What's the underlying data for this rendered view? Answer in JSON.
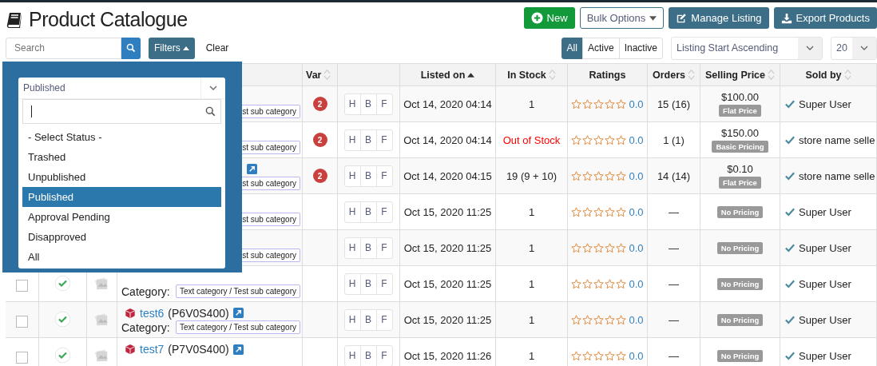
{
  "page_title": "Product Catalogue",
  "actions": [
    {
      "kind": "new",
      "label": "New"
    },
    {
      "kind": "bulk",
      "label": "Bulk Options"
    },
    {
      "kind": "manage",
      "label": "Manage Listing"
    },
    {
      "kind": "export",
      "label": "Export Products"
    }
  ],
  "search": {
    "placeholder": "Search"
  },
  "filters_button": {
    "label": "Filters",
    "expanded": true
  },
  "clear_link": "Clear",
  "status_tabs": [
    {
      "label": "All",
      "selected": true
    },
    {
      "label": "Active",
      "selected": false
    },
    {
      "label": "Inactive",
      "selected": false
    }
  ],
  "sort_select": {
    "value": "Listing Start Ascending"
  },
  "page_size_select": {
    "value": "20"
  },
  "filter_panel": {
    "status_select": {
      "value": "Published",
      "expanded": true
    },
    "options": [
      {
        "label": "- Select Status -",
        "selected": false
      },
      {
        "label": "Trashed",
        "selected": false
      },
      {
        "label": "Unpublished",
        "selected": false
      },
      {
        "label": "Published",
        "selected": true
      },
      {
        "label": "Approval Pending",
        "selected": false
      },
      {
        "label": "Disapproved",
        "selected": false
      },
      {
        "label": "All",
        "selected": false
      }
    ]
  },
  "table": {
    "columns": [
      {
        "label": "Var",
        "sortable": true,
        "sorted": false
      },
      {
        "sortable": false,
        "sorted": false
      },
      {
        "label": "Listed on",
        "sortable": true,
        "sorted": true
      },
      {
        "label": "In Stock",
        "sortable": true,
        "sorted": false
      },
      {
        "label": "Ratings",
        "sortable": false,
        "sorted": false
      },
      {
        "label": "Orders",
        "sortable": true,
        "sorted": false
      },
      {
        "label": "Selling Price",
        "sortable": true,
        "sorted": false
      },
      {
        "label": "Sold by",
        "sortable": true,
        "sorted": false
      }
    ],
    "rows": [
      {
        "product": {
          "category": "st sub category"
        },
        "variants": "2",
        "flags": [
          "H",
          "B",
          "F"
        ],
        "listed_on": "Oct 14, 2020 04:14",
        "in_stock": "1",
        "out_of_stock": false,
        "stars": 0,
        "rating": "0.0",
        "orders": "15 (16)",
        "price": "$100.00",
        "pricing": "Flat Price",
        "seller": "Super User"
      },
      {
        "product": {
          "category": "st sub category"
        },
        "variants": "2",
        "flags": [
          "H",
          "B",
          "F"
        ],
        "listed_on": "Oct 14, 2020 04:14",
        "in_stock": "Out of Stock",
        "out_of_stock": true,
        "stars": 0,
        "rating": "0.0",
        "orders": "1 (1)",
        "price": "$150.00",
        "pricing": "Basic Pricing",
        "seller": "store name selle"
      },
      {
        "product": {
          "link": true,
          "category": "st sub category"
        },
        "variants": "2",
        "flags": [
          "H",
          "B",
          "F"
        ],
        "listed_on": "Oct 14, 2020 04:15",
        "in_stock": "19 (9 + 10)",
        "out_of_stock": false,
        "stars": 0,
        "rating": "0.0",
        "orders": "14 (14)",
        "price": "$0.10",
        "pricing": "Flat Price",
        "seller": "store name selle"
      },
      {
        "product": {
          "category": "st sub category"
        },
        "flags": [
          "H",
          "B",
          "F"
        ],
        "listed_on": "Oct 15, 2020 11:25",
        "in_stock": "1",
        "out_of_stock": false,
        "stars": 0,
        "rating": "0.0",
        "orders": "—",
        "pricing": "No Pricing",
        "seller": "Super User"
      },
      {
        "product": {
          "category": "st sub category"
        },
        "flags": [
          "H",
          "B",
          "F"
        ],
        "listed_on": "Oct 15, 2020 11:25",
        "in_stock": "1",
        "out_of_stock": false,
        "stars": 0,
        "rating": "0.0",
        "orders": "—",
        "pricing": "No Pricing",
        "seller": "Super User"
      },
      {
        "checked": false,
        "approved": true,
        "product": {
          "category_label": "Category:",
          "category": "Text category / Test sub category"
        },
        "flags": [
          "H",
          "B",
          "F"
        ],
        "listed_on": "Oct 15, 2020 11:25",
        "in_stock": "1",
        "out_of_stock": false,
        "stars": 0,
        "rating": "0.0",
        "orders": "—",
        "pricing": "No Pricing",
        "seller": "Super User"
      },
      {
        "checked": false,
        "approved": true,
        "product": {
          "name": "test6",
          "sku": "(P6V0S400)",
          "link": true,
          "category_label": "Category:",
          "category": "Text category / Test sub category"
        },
        "flags": [
          "H",
          "B",
          "F"
        ],
        "listed_on": "Oct 15, 2020 11:25",
        "in_stock": "1",
        "out_of_stock": false,
        "stars": 0,
        "rating": "0.0",
        "orders": "—",
        "pricing": "No Pricing",
        "seller": "Super User"
      },
      {
        "checked": false,
        "approved": true,
        "product": {
          "name": "test7",
          "sku": "(P7V0S400)",
          "link": true
        },
        "flags": [
          "H",
          "B",
          "F"
        ],
        "listed_on": "Oct 15, 2020 11:26",
        "in_stock": "1",
        "out_of_stock": false,
        "stars": 0,
        "rating": "0.0",
        "orders": "—",
        "pricing": "No Pricing",
        "seller": "Super User"
      }
    ]
  }
}
